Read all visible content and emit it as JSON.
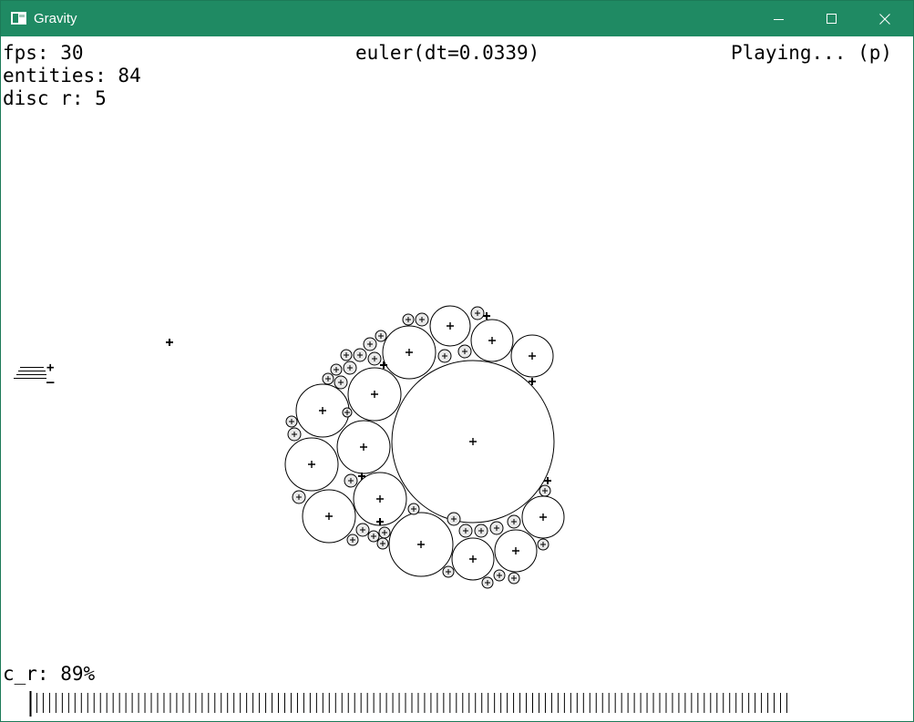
{
  "window": {
    "title": "Gravity",
    "icon": "app-window-icon",
    "controls": [
      "minimize-icon",
      "maximize-icon",
      "close-icon"
    ]
  },
  "hud": {
    "fps": "fps: 30",
    "entities": "entities: 84",
    "disc_r": "disc r: 5",
    "integrator": "euler(dt=0.0339)",
    "status": "Playing... (p)",
    "c_r": "c_r: 89%"
  },
  "zoom_control": {
    "plus": "+",
    "minus": "–"
  },
  "slider": {
    "value_percent": 89,
    "tick_count": 120
  },
  "colors": {
    "titlebar": "#1f8a63",
    "canvas": "#ffffff",
    "ink": "#000000"
  }
}
